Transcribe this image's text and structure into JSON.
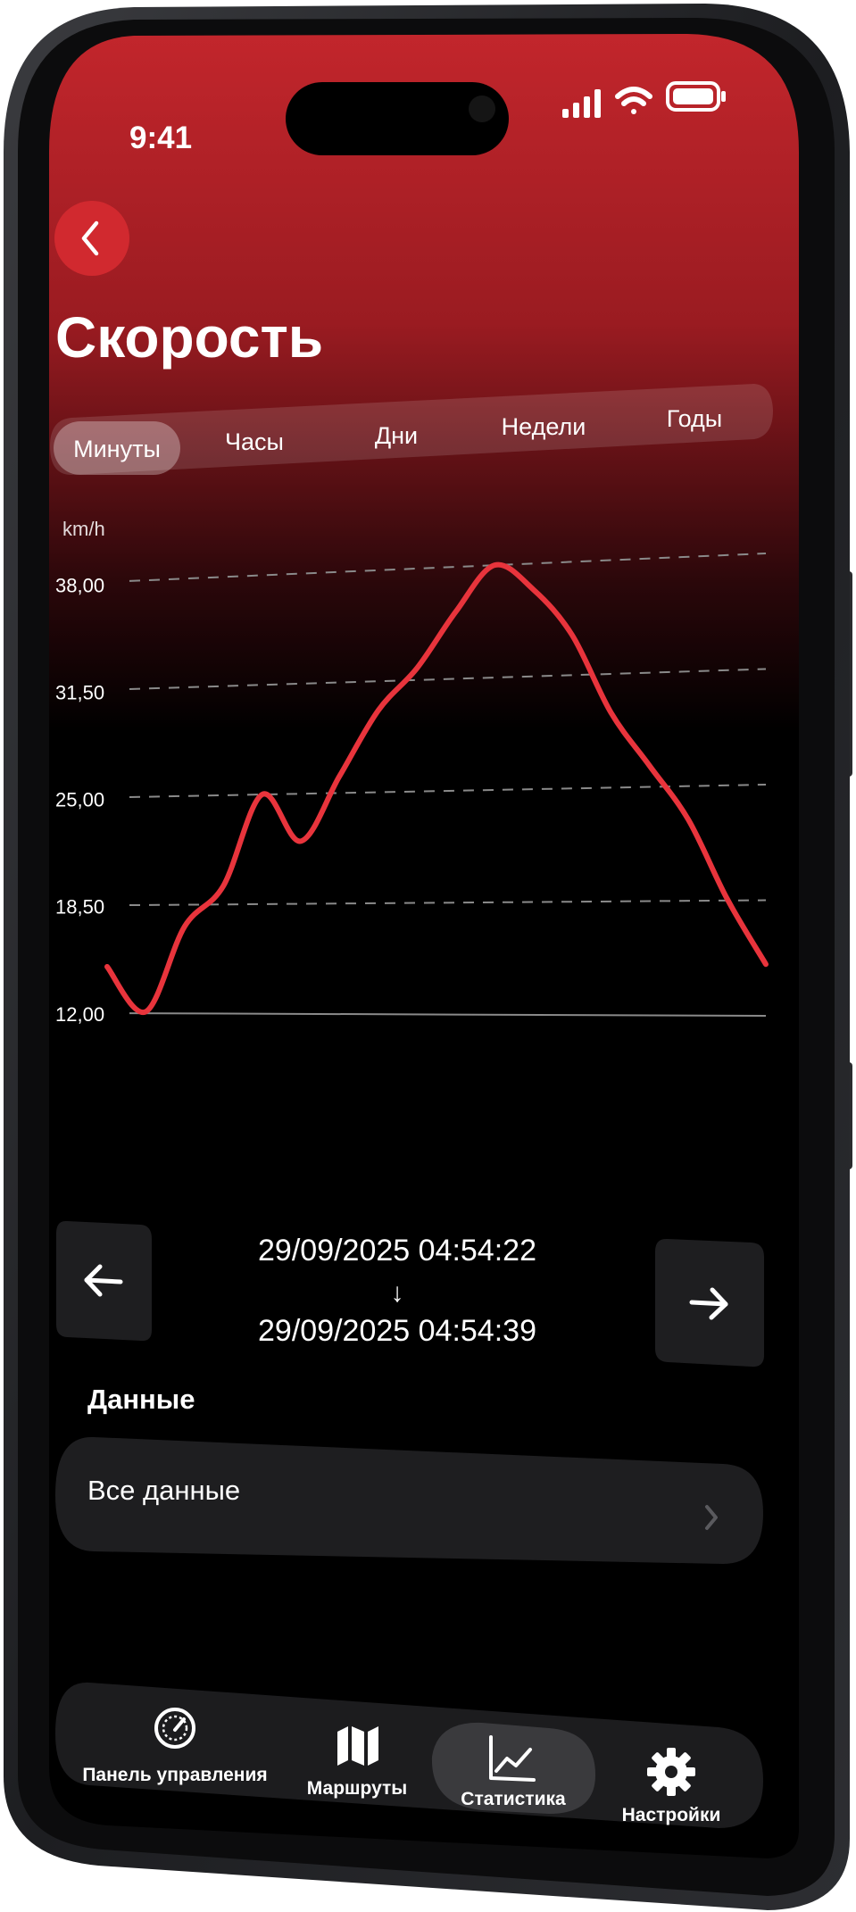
{
  "status_bar": {
    "time": "9:41"
  },
  "header": {
    "back_icon": "chevron-left-icon",
    "title": "Скорость"
  },
  "range_tabs": [
    {
      "label": "Минуты",
      "selected": true
    },
    {
      "label": "Часы",
      "selected": false
    },
    {
      "label": "Дни",
      "selected": false
    },
    {
      "label": "Недели",
      "selected": false
    },
    {
      "label": "Годы",
      "selected": false
    }
  ],
  "chart_data": {
    "type": "line",
    "ylabel": "km/h",
    "ylim": [
      12,
      38
    ],
    "y_ticks": [
      "38,00",
      "31,50",
      "25,00",
      "18,50",
      "12,00"
    ],
    "grid": "dashed-horizontal",
    "line_color": "#e8343c",
    "series": [
      {
        "values": [
          14.8,
          12.1,
          17.2,
          19.6,
          25.0,
          22.2,
          26.0,
          29.8,
          32.2,
          35.4,
          38.0,
          36.5,
          33.8,
          29.3,
          26.2,
          23.1,
          18.6,
          14.9
        ]
      }
    ]
  },
  "time_range": {
    "start": "29/09/2025 04:54:22",
    "arrow": "↓",
    "end": "29/09/2025 04:54:39",
    "prev_icon": "arrow-left-icon",
    "next_icon": "arrow-right-icon"
  },
  "data_section": {
    "heading": "Данные",
    "row_label": "Все данные",
    "row_icon": "chevron-right-icon"
  },
  "tab_bar": {
    "items": [
      {
        "label": "Панель управления",
        "icon": "speedometer-icon",
        "active": false
      },
      {
        "label": "Маршруты",
        "icon": "map-icon",
        "active": false
      },
      {
        "label": "Статистика",
        "icon": "line-chart-icon",
        "active": true
      },
      {
        "label": "Настройки",
        "icon": "gear-icon",
        "active": false
      }
    ]
  },
  "colors": {
    "accent": "#e8343c",
    "header_red": "#c3262c",
    "background": "#000000"
  }
}
